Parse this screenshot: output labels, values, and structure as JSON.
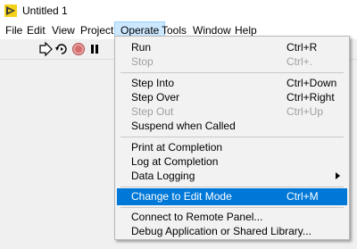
{
  "window": {
    "title": "Untitled 1"
  },
  "menubar": {
    "items": [
      "File",
      "Edit",
      "View",
      "Project",
      "Operate",
      "Tools",
      "Window",
      "Help"
    ],
    "active": "Operate"
  },
  "operate_menu": {
    "items": [
      {
        "label": "Run",
        "shortcut": "Ctrl+R",
        "enabled": true
      },
      {
        "label": "Stop",
        "shortcut": "Ctrl+.",
        "enabled": false
      },
      {
        "label": "Step Into",
        "shortcut": "Ctrl+Down",
        "enabled": true
      },
      {
        "label": "Step Over",
        "shortcut": "Ctrl+Right",
        "enabled": true
      },
      {
        "label": "Step Out",
        "shortcut": "Ctrl+Up",
        "enabled": false
      },
      {
        "label": "Suspend when Called",
        "shortcut": "",
        "enabled": true
      },
      {
        "label": "Print at Completion",
        "shortcut": "",
        "enabled": true
      },
      {
        "label": "Log at Completion",
        "shortcut": "",
        "enabled": true
      },
      {
        "label": "Data Logging",
        "shortcut": "",
        "enabled": true,
        "submenu": true
      },
      {
        "label": "Change to Edit Mode",
        "shortcut": "Ctrl+M",
        "enabled": true,
        "highlighted": true
      },
      {
        "label": "Connect to Remote Panel...",
        "shortcut": "",
        "enabled": true
      },
      {
        "label": "Debug Application or Shared Library...",
        "shortcut": "",
        "enabled": true
      }
    ]
  },
  "toolbar": {
    "icons": [
      "run-arrow-icon",
      "run-continuously-icon",
      "abort-icon",
      "pause-icon"
    ]
  },
  "colors": {
    "highlight": "#0078d7",
    "menu_active_bg": "#cce8ff",
    "disabled_text": "#a0a0a0"
  }
}
